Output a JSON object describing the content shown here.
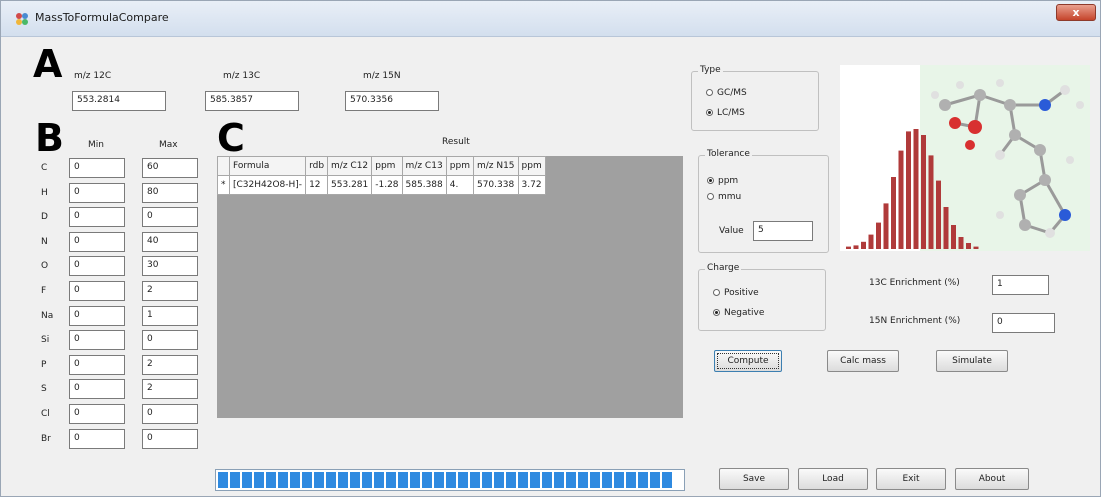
{
  "window": {
    "title": "MassToFormulaCompare",
    "close_label": "x"
  },
  "section_letters": {
    "a": "A",
    "b": "B",
    "c": "C"
  },
  "mz": {
    "label_12c": "m/z 12C",
    "value_12c": "553.2814",
    "label_13c": "m/z 13C",
    "value_13c": "585.3857",
    "label_15n": "m/z 15N",
    "value_15n": "570.3356"
  },
  "elements": {
    "min_header": "Min",
    "max_header": "Max",
    "rows": [
      {
        "symbol": "C",
        "min": "0",
        "max": "60"
      },
      {
        "symbol": "H",
        "min": "0",
        "max": "80"
      },
      {
        "symbol": "D",
        "min": "0",
        "max": "0"
      },
      {
        "symbol": "N",
        "min": "0",
        "max": "40"
      },
      {
        "symbol": "O",
        "min": "0",
        "max": "30"
      },
      {
        "symbol": "F",
        "min": "0",
        "max": "2"
      },
      {
        "symbol": "Na",
        "min": "0",
        "max": "1"
      },
      {
        "symbol": "Si",
        "min": "0",
        "max": "0"
      },
      {
        "symbol": "P",
        "min": "0",
        "max": "2"
      },
      {
        "symbol": "S",
        "min": "0",
        "max": "2"
      },
      {
        "symbol": "Cl",
        "min": "0",
        "max": "0"
      },
      {
        "symbol": "Br",
        "min": "0",
        "max": "0"
      }
    ]
  },
  "result": {
    "label": "Result",
    "columns": [
      "Formula",
      "rdb",
      "m/z C12",
      "ppm",
      "m/z C13",
      "ppm",
      "m/z N15",
      "ppm"
    ],
    "rows": [
      {
        "marker": "*",
        "cells": [
          "[C32H42O8-H]-",
          "12",
          "553.281",
          "-1.28",
          "585.388",
          "4.",
          "570.338",
          "3.72"
        ]
      }
    ]
  },
  "type_group": {
    "title": "Type",
    "options": [
      "GC/MS",
      "LC/MS"
    ],
    "selected": "LC/MS"
  },
  "tolerance_group": {
    "title": "Tolerance",
    "options": [
      "ppm",
      "mmu"
    ],
    "selected": "ppm",
    "value_label": "Value",
    "value": "5"
  },
  "charge_group": {
    "title": "Charge",
    "options": [
      "Positive",
      "Negative"
    ],
    "selected": "Negative"
  },
  "enrichment": {
    "c13_label": "13C Enrichment (%)",
    "c13_value": "1",
    "n15_label": "15N Enrichment (%)",
    "n15_value": "0"
  },
  "buttons": {
    "compute": "Compute",
    "calc_mass": "Calc mass",
    "simulate": "Simulate",
    "save": "Save",
    "load": "Load",
    "exit": "Exit",
    "about": "About"
  },
  "progress": {
    "fraction": 1.0
  },
  "histogram": {
    "values": [
      2,
      3,
      6,
      12,
      22,
      38,
      60,
      82,
      98,
      100,
      95,
      78,
      57,
      35,
      20,
      10,
      5,
      2
    ]
  },
  "colors": {
    "bar": "#b03a3a",
    "progress": "#2f8ae0",
    "panel_bg": "#e8f5e8"
  }
}
